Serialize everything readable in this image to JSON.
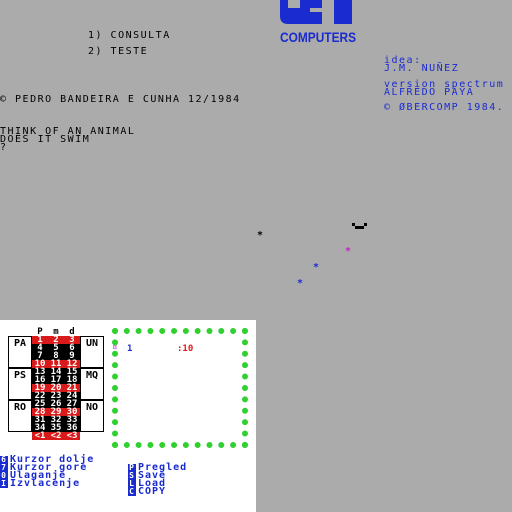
{
  "colors": {
    "background": "#ababab",
    "accent": "#1a2bd0",
    "red": "#d81a1a",
    "green": "#2fd02f",
    "magenta": "#c020c0"
  },
  "logo": {
    "text": "COMPUTERS"
  },
  "menu": {
    "opt1": "1) CONSULTA",
    "opt2": "2) TESTE"
  },
  "credits": {
    "idea_label": "idea:",
    "idea_name": "J.M. NUÑEZ",
    "version": "version spectrum",
    "author": "ALFREDO PAYA",
    "copyright": "© ØBERCOMP 1984."
  },
  "copyright_line": "© PEDRO BANDEIRA E CUNHA 12/1984",
  "game": {
    "line1": "THINK OF AN ANIMAL",
    "line2": "DOES IT SWIM",
    "prompt": "?"
  },
  "sprites": {
    "star": "*",
    "face": "▀▄▄▀"
  },
  "panel": {
    "left_boxes": [
      "PA",
      "PS",
      "RO"
    ],
    "right_boxes": [
      "UN",
      "MQ",
      "NO"
    ],
    "calendar_header": [
      "P",
      "m",
      "d"
    ],
    "calendar_rows": [
      [
        "1",
        "2",
        "3"
      ],
      [
        "4",
        "5",
        "6"
      ],
      [
        "7",
        "8",
        "9"
      ],
      [
        "10",
        "11",
        "12"
      ],
      [
        "13",
        "14",
        "15"
      ],
      [
        "16",
        "17",
        "18"
      ],
      [
        "19",
        "20",
        "21"
      ],
      [
        "22",
        "23",
        "24"
      ],
      [
        "25",
        "26",
        "27"
      ],
      [
        "28",
        "29",
        "30"
      ],
      [
        "31",
        "32",
        "33"
      ],
      [
        "34",
        "35",
        "36"
      ],
      [
        "<1",
        "<2",
        "<3"
      ]
    ],
    "frame_cursor": "¤",
    "frame_value1": "1",
    "frame_value2": ":10",
    "left_menu": [
      {
        "key": "6",
        "label": "Kurzor dolje"
      },
      {
        "key": "7",
        "label": "Kurzor gore"
      },
      {
        "key": "0",
        "label": "Ulaganje"
      },
      {
        "key": "I",
        "label": "Izvlacenje"
      }
    ],
    "right_menu": [
      {
        "key": "P",
        "label": "Pregled"
      },
      {
        "key": "S",
        "label": "Save"
      },
      {
        "key": "L",
        "label": "Load"
      },
      {
        "key": "C",
        "label": "COPY"
      }
    ]
  }
}
